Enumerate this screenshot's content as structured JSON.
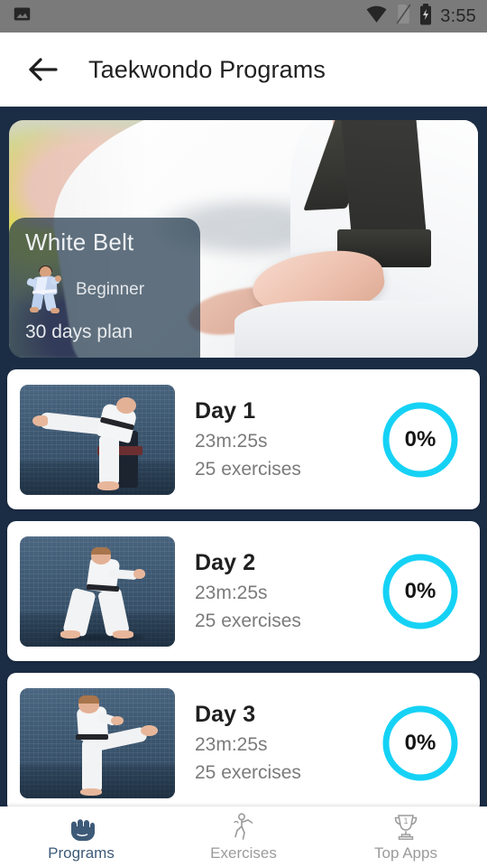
{
  "statusbar": {
    "time": "3:55",
    "icons": [
      "image-icon",
      "wifi-icon",
      "sim-card-off-icon",
      "battery-charging-icon"
    ]
  },
  "toolbar": {
    "back_icon": "back-arrow-icon",
    "title": "Taekwondo Programs"
  },
  "hero": {
    "belt": "White Belt",
    "level": "Beginner",
    "level_icon": "karate-figure-icon",
    "plan": "30 days plan"
  },
  "days": [
    {
      "title": "Day 1",
      "duration": "23m:25s",
      "exercises": "25 exercises",
      "progress": "0%",
      "progress_value": 0,
      "thumb_icon": "side-kick-over-chair-thumbnail"
    },
    {
      "title": "Day 2",
      "duration": "23m:25s",
      "exercises": "25 exercises",
      "progress": "0%",
      "progress_value": 0,
      "thumb_icon": "walking-stance-punch-thumbnail"
    },
    {
      "title": "Day 3",
      "duration": "23m:25s",
      "exercises": "25 exercises",
      "progress": "0%",
      "progress_value": 0,
      "thumb_icon": "high-front-kick-thumbnail"
    }
  ],
  "bottomnav": {
    "items": [
      {
        "label": "Programs",
        "icon": "fist-icon",
        "active": true
      },
      {
        "label": "Exercises",
        "icon": "kick-figure-icon",
        "active": false
      },
      {
        "label": "Top Apps",
        "icon": "trophy-icon",
        "active": false
      }
    ],
    "trophy_number": "1"
  },
  "colors": {
    "page_background": "#1b2d45",
    "accent_progress": "#15d2f5",
    "nav_active": "#3d5a78",
    "nav_inactive": "#9b9b9b",
    "statusbar": "#7a7a7a",
    "card": "#ffffff"
  }
}
